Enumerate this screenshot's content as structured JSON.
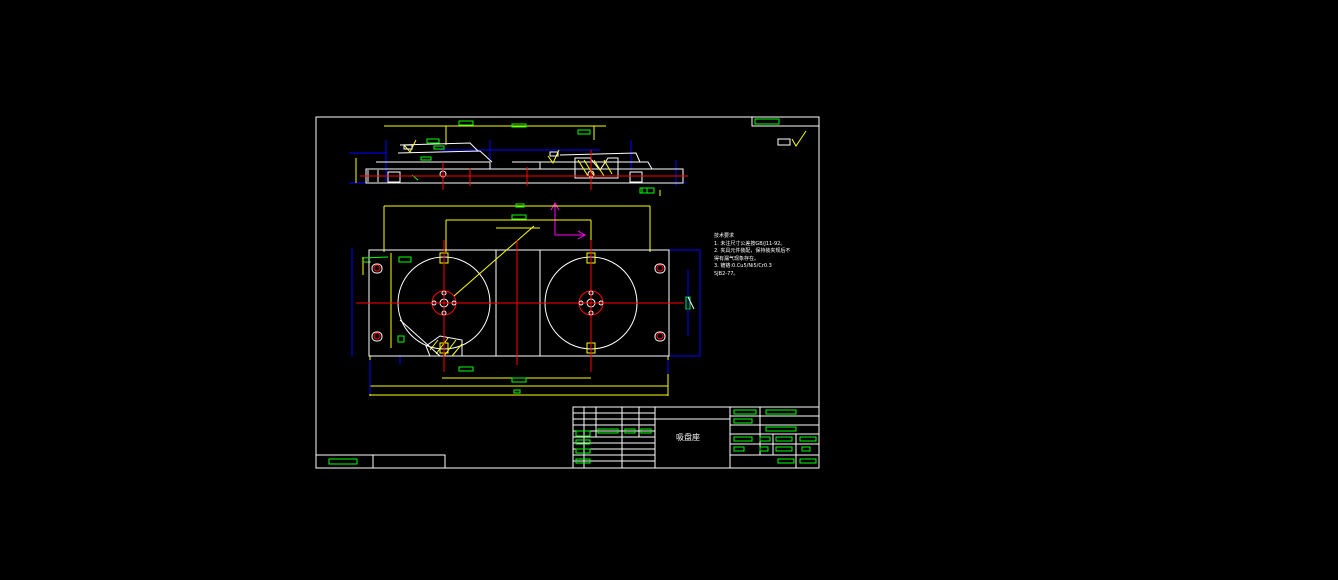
{
  "drawing": {
    "part_name": "吸盘座",
    "technical_requirements": {
      "heading": "技术要求",
      "items": [
        "1. 未注尺寸公差按GB/J11-92。",
        "2. 夹具元件装配，保持装夹规后不",
        "得有漏气现象存在。",
        "3. 镀铬:0.Cu5/Ni5/Cr0.3",
        "5JB2-77。"
      ]
    },
    "colors": {
      "background": "#000000",
      "frame": "#ffffff",
      "outline": "#ffffff",
      "dimension": "#ffff00",
      "centerline": "#ff0000",
      "construction": "#0000ff",
      "annotation": "#00ff00",
      "ucs": "#ff00ff"
    }
  }
}
